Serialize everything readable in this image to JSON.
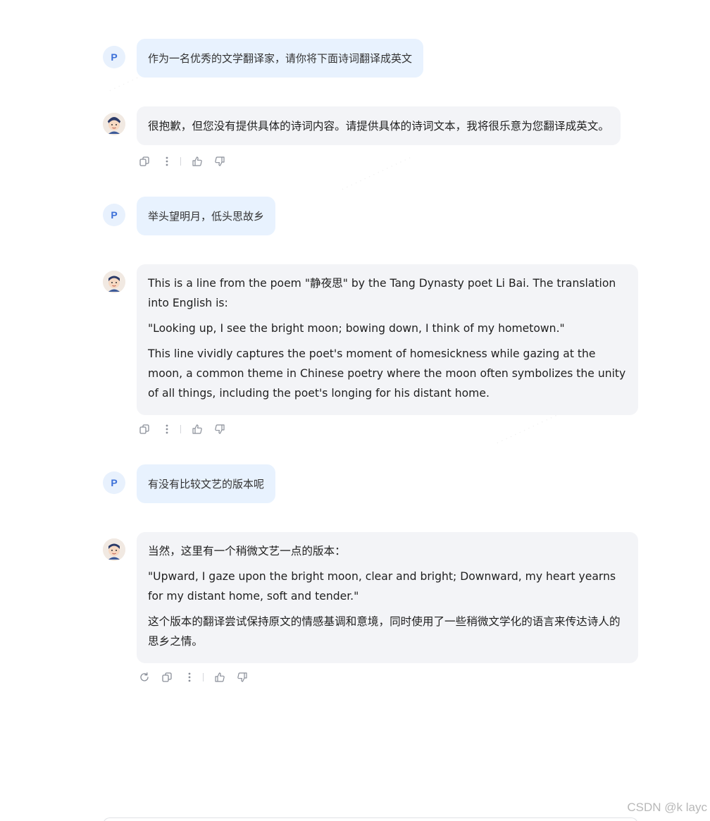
{
  "conversation": {
    "user_avatar_letter": "P",
    "messages": [
      {
        "role": "user",
        "text": "作为一名优秀的文学翻译家，请你将下面诗词翻译成英文"
      },
      {
        "role": "assistant",
        "paragraphs": [
          "很抱歉，但您没有提供具体的诗词内容。请提供具体的诗词文本，我将很乐意为您翻译成英文。"
        ]
      },
      {
        "role": "user",
        "text": "举头望明月，低头思故乡"
      },
      {
        "role": "assistant",
        "paragraphs": [
          "This is a line from the poem \"静夜思\" by the Tang Dynasty poet Li Bai. The translation into English is:",
          "\"Looking up, I see the bright moon; bowing down, I think of my hometown.\"",
          "This line vividly captures the poet's moment of homesickness while gazing at the moon, a common theme in Chinese poetry where the moon often symbolizes the unity of all things, including the poet's longing for his distant home."
        ]
      },
      {
        "role": "user",
        "text": "有没有比较文艺的版本呢"
      },
      {
        "role": "assistant",
        "paragraphs": [
          "当然，这里有一个稍微文艺一点的版本：",
          "\"Upward, I gaze upon the bright moon, clear and bright; Downward, my heart yearns for my distant home, soft and tender.\"",
          "这个版本的翻译尝试保持原文的情感基调和意境，同时使用了一些稍微文学化的语言来传达诗人的思乡之情。"
        ]
      }
    ]
  },
  "icons": {
    "copy": "copy-icon",
    "more": "more-vertical-icon",
    "like": "thumbs-up-icon",
    "dislike": "thumbs-down-icon",
    "regenerate": "refresh-icon"
  },
  "colors": {
    "user_bubble": "#e8f2fe",
    "assistant_bubble": "#f3f4f7",
    "accent": "#3b6fd8"
  },
  "footer": {
    "credit": "CSDN @k layc"
  }
}
